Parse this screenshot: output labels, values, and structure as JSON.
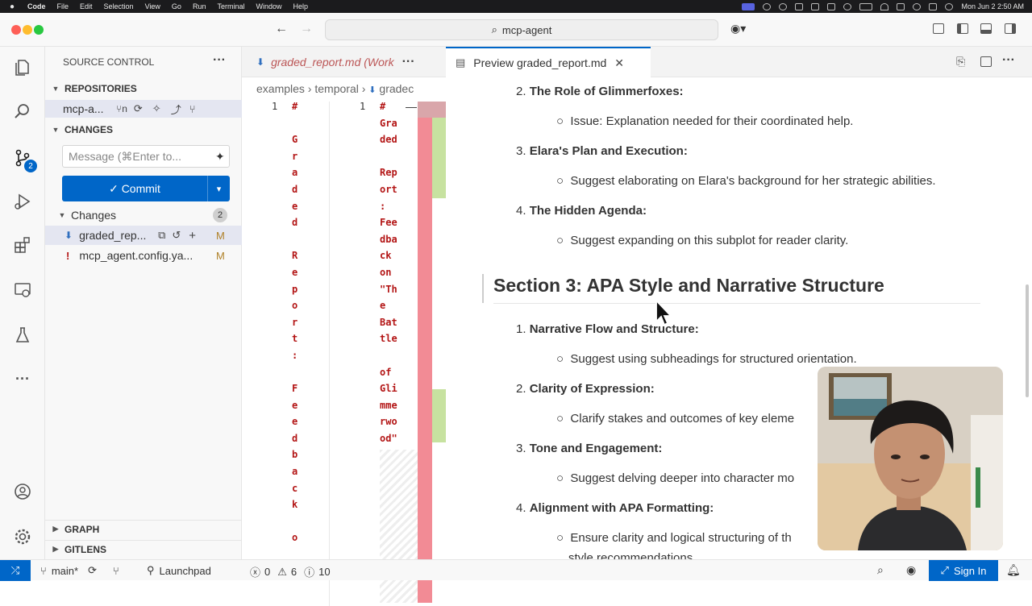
{
  "menubar": {
    "app": "Code",
    "items": [
      "File",
      "Edit",
      "Selection",
      "View",
      "Go",
      "Run",
      "Terminal",
      "Window",
      "Help"
    ],
    "clock": "Mon Jun 2  2:50 AM"
  },
  "titlebar": {
    "search": "mcp-agent"
  },
  "sidebar": {
    "title": "SOURCE CONTROL",
    "repositories_label": "REPOSITORIES",
    "repo_name": "mcp-a...",
    "changes_label": "CHANGES",
    "message_placeholder": "Message (⌘Enter to...",
    "commit_label": "Commit",
    "changes_group": "Changes",
    "changes_count": "2",
    "files": [
      {
        "name": "graded_rep...",
        "status": "M"
      },
      {
        "name": "mcp_agent.config.ya...",
        "status": "M"
      }
    ],
    "graph_label": "GRAPH",
    "gitlens_label": "GITLENS"
  },
  "editor_left": {
    "tab_label": "graded_report.md (Work",
    "breadcrumbs": [
      "examples",
      "temporal",
      "gradec"
    ],
    "line_number_left": "1",
    "line_number_right": "1",
    "left_code": "#\n\nG\nr\na\nd\ne\nd\n\nR\ne\np\no\nr\nt\n:\n\nF\ne\ne\nd\nb\na\nc\nk\n\no",
    "right_code": "#\nGra\nded\n\nRep\nort\n:\nFee\ndba\nck\non\n\"Th\ne\nBat\ntle\n\nof\nGli\nmme\nrwo\nod\""
  },
  "preview": {
    "tab_label": "Preview graded_report.md",
    "items": [
      {
        "num": "2.",
        "title": "The Role of Glimmerfoxes:",
        "bullet": "Issue: Explanation needed for their coordinated help."
      },
      {
        "num": "3.",
        "title": "Elara's Plan and Execution:",
        "bullet": "Suggest elaborating on Elara's background for her strategic abilities."
      },
      {
        "num": "4.",
        "title": "The Hidden Agenda:",
        "bullet": "Suggest expanding on this subplot for reader clarity."
      }
    ],
    "section_heading": "Section 3: APA Style and Narrative Structure",
    "items2": [
      {
        "num": "1.",
        "title": "Narrative Flow and Structure:",
        "bullet": "Suggest using subheadings for structured orientation."
      },
      {
        "num": "2.",
        "title": "Clarity of Expression:",
        "bullet": "Clarify stakes and outcomes of key eleme"
      },
      {
        "num": "3.",
        "title": "Tone and Engagement:",
        "bullet": "Suggest delving deeper into character mo"
      },
      {
        "num": "4.",
        "title": "Alignment with APA Formatting:",
        "bullet": "Ensure clarity and logical structuring of th"
      }
    ],
    "cutoff_line": "style recommendations"
  },
  "statusbar": {
    "branch": "main*",
    "launchpad": "Launchpad",
    "errors": "0",
    "warnings": "6",
    "info": "10",
    "signin": "Sign In"
  },
  "colors": {
    "accent": "#0066c8",
    "modified": "#b0822a",
    "diff_red": "#f28b95",
    "diff_green": "#c7e2a0"
  }
}
